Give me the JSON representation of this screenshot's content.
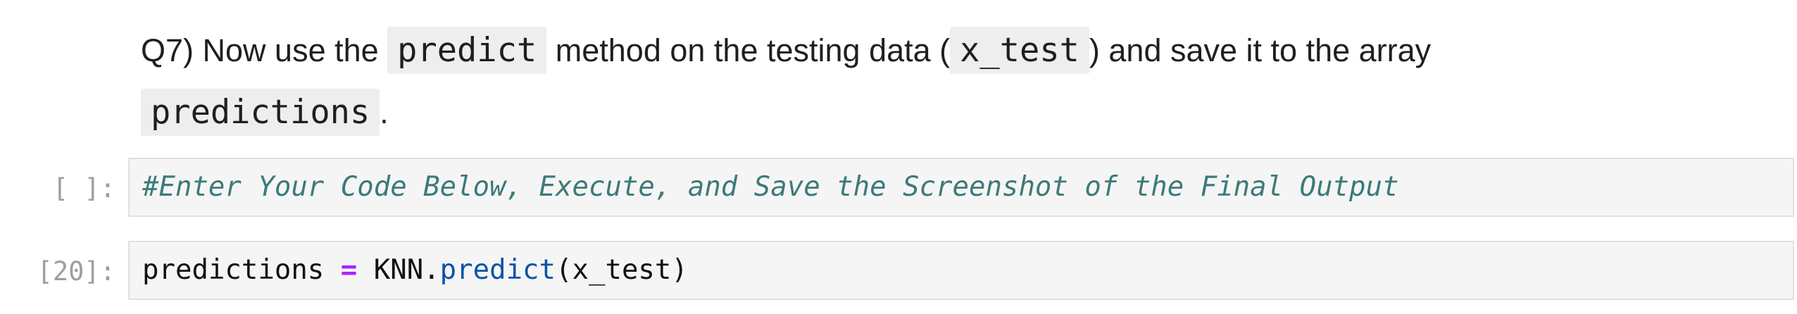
{
  "question": {
    "prefix": "Q7) Now use the",
    "code1": "predict",
    "middle": "method on the testing data (",
    "code2": "x_test",
    "after": ") and save it to the array",
    "code3": "predictions",
    "end": "."
  },
  "cells": [
    {
      "prompt": "[ ]:",
      "comment": "#Enter Your Code Below, Execute, and Save the Screenshot of the Final Output"
    },
    {
      "prompt": "[20]:",
      "var": "predictions",
      "op": "=",
      "obj": "KNN.",
      "method": "predict",
      "args": "(x_test)"
    }
  ]
}
